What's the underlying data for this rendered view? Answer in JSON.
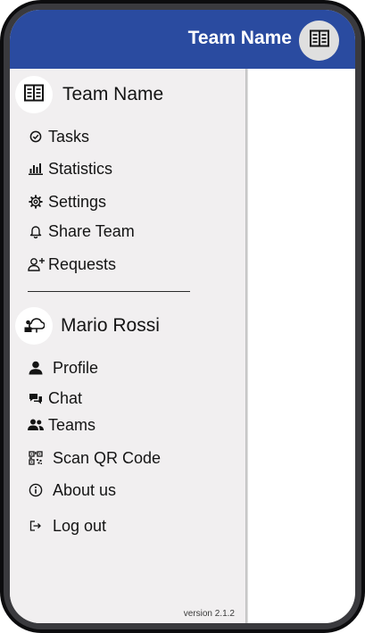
{
  "app_bar": {
    "title": "Team Name",
    "avatar_icon": "team-list-icon",
    "color": "#2a4ba0"
  },
  "drawer": {
    "team_section": {
      "title": "Team Name",
      "avatar_icon": "team-list-icon",
      "items": [
        {
          "label": "Tasks",
          "icon": "check-circle-icon"
        },
        {
          "label": "Statistics",
          "icon": "bar-chart-icon"
        },
        {
          "label": "Settings",
          "icon": "gear-icon"
        },
        {
          "label": "Share Team",
          "icon": "bell-icon"
        },
        {
          "label": "Requests",
          "icon": "add-user-icon"
        }
      ]
    },
    "user_section": {
      "title": "Mario Rossi",
      "avatar_icon": "user-avatar-icon",
      "items": [
        {
          "label": "Profile",
          "icon": "person-icon"
        },
        {
          "label": "Chat",
          "icon": "chat-bubbles-icon"
        },
        {
          "label": "Teams",
          "icon": "people-icon"
        },
        {
          "label": "Scan QR Code",
          "icon": "qr-code-icon"
        },
        {
          "label": "About us",
          "icon": "info-icon"
        },
        {
          "label": "Log out",
          "icon": "logout-icon"
        }
      ]
    },
    "version": "version 2.1.2"
  }
}
